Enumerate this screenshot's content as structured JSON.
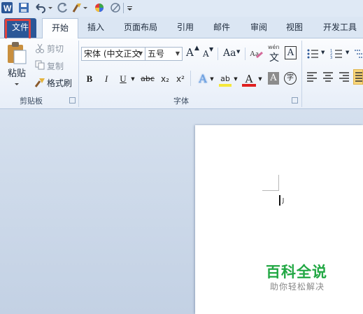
{
  "tabs": {
    "file": "文件",
    "home": "开始",
    "insert": "插入",
    "page_layout": "页面布局",
    "references": "引用",
    "mailings": "邮件",
    "review": "审阅",
    "view": "视图",
    "developer": "开发工具"
  },
  "clipboard": {
    "paste": "粘贴",
    "cut": "剪切",
    "copy": "复制",
    "format_painter": "格式刷",
    "group_label": "剪贴板"
  },
  "font": {
    "name_value": "宋体 (中文正文",
    "size_value": "五号",
    "grow_label": "A",
    "shrink_label": "A",
    "case_label": "Aa",
    "phonetic_label": "wén",
    "phonetic_char": "文",
    "border_label": "A",
    "bold": "B",
    "italic": "I",
    "underline": "U",
    "strike": "abc",
    "subscript": "x₂",
    "superscript": "x²",
    "effects": "A",
    "highlight": "ab",
    "color": "A",
    "shading": "A",
    "enclose": "字",
    "group_label": "字体"
  },
  "watermark": {
    "title": "百科全说",
    "subtitle": "助你轻松解决"
  },
  "colors": {
    "file_tab": "#2b5797",
    "highlight_box": "#e0433f",
    "watermark_green": "#22a844",
    "font_color_bar": "#e02020",
    "highlight_bar": "#f5e83a"
  }
}
